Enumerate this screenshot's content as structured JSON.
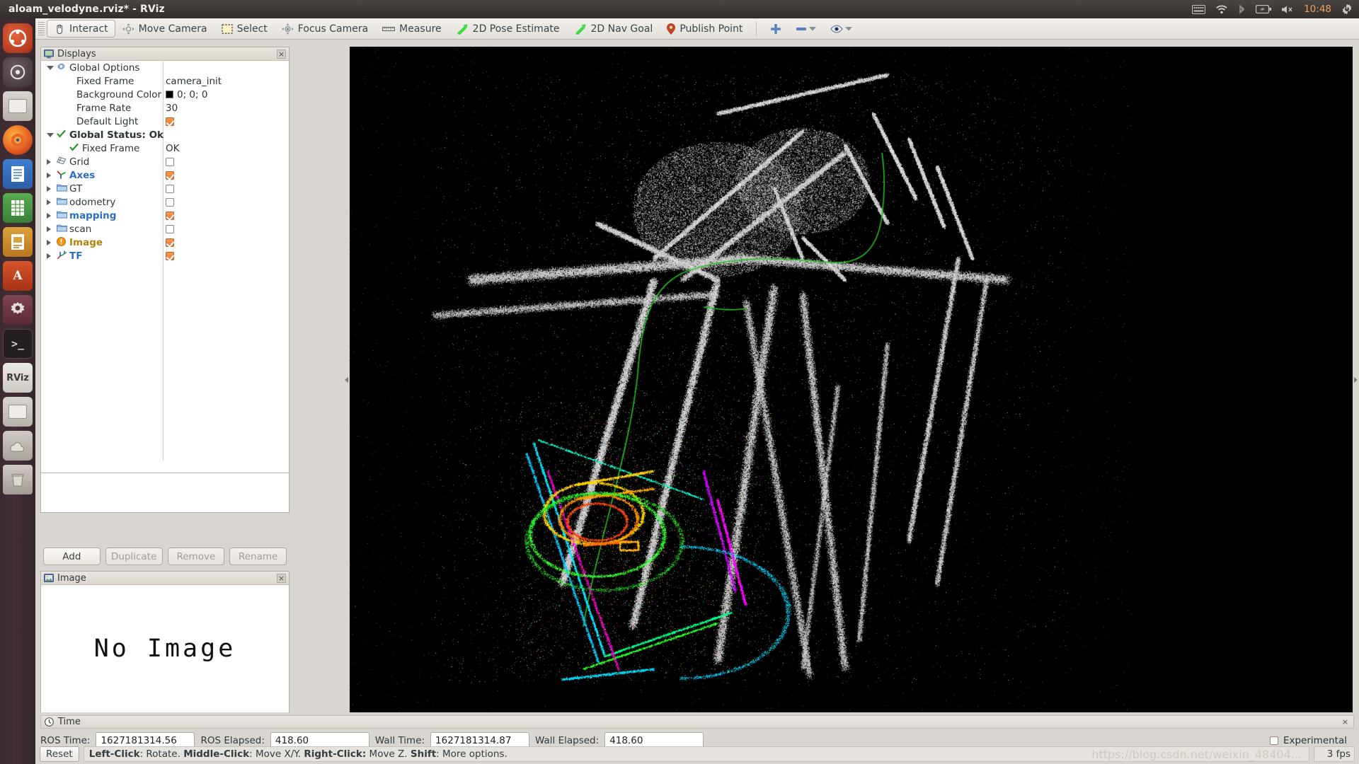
{
  "window": {
    "title": "aloam_velodyne.rviz* - RViz"
  },
  "tray": {
    "clock": "10:48",
    "icons": [
      "keyboard-icon",
      "wifi-icon",
      "bluetooth-icon",
      "battery-icon",
      "volume-muted-icon",
      "power-gear-icon"
    ]
  },
  "launcher": {
    "items": [
      "ubuntu-dash",
      "files-manager",
      "firefox",
      "libreoffice-writer",
      "libreoffice-calc",
      "libreoffice-impress",
      "amazon",
      "system-settings",
      "terminal",
      "rviz",
      "archive-manager",
      "software-updater",
      "trash"
    ],
    "rviz_label": "RViz"
  },
  "toolbar": {
    "tools": [
      {
        "label": "Interact",
        "icon": "hand-cursor-icon",
        "active": true
      },
      {
        "label": "Move Camera",
        "icon": "move-camera-icon",
        "active": false
      },
      {
        "label": "Select",
        "icon": "selection-box-icon",
        "active": false
      },
      {
        "label": "Focus Camera",
        "icon": "focus-camera-icon",
        "active": false
      },
      {
        "label": "Measure",
        "icon": "ruler-icon",
        "active": false
      },
      {
        "label": "2D Pose Estimate",
        "icon": "green-arrow-icon",
        "active": false
      },
      {
        "label": "2D Nav Goal",
        "icon": "green-arrow-icon",
        "active": false
      },
      {
        "label": "Publish Point",
        "icon": "map-pin-icon",
        "active": false
      }
    ],
    "extras": [
      "plus-icon",
      "minus-icon",
      "chevron-down-icon",
      "eye-icon",
      "chevron-down-icon"
    ]
  },
  "displays_panel": {
    "title": "Displays",
    "icon": "monitor-icon",
    "close_label": "×",
    "tree": [
      {
        "indent": 0,
        "expander": "open",
        "icon": "gear-icon",
        "label": "Global Options",
        "bold": false,
        "color": "#2e3436",
        "value_type": "none",
        "value": ""
      },
      {
        "indent": 1,
        "expander": "none",
        "icon": "none",
        "label": "Fixed Frame",
        "bold": false,
        "color": "#2e3436",
        "value_type": "text",
        "value": "camera_init"
      },
      {
        "indent": 1,
        "expander": "none",
        "icon": "none",
        "label": "Background Color",
        "bold": false,
        "color": "#2e3436",
        "value_type": "swatch",
        "value": "0; 0; 0",
        "swatch_color": "#000000"
      },
      {
        "indent": 1,
        "expander": "none",
        "icon": "none",
        "label": "Frame Rate",
        "bold": false,
        "color": "#2e3436",
        "value_type": "text",
        "value": "30"
      },
      {
        "indent": 1,
        "expander": "none",
        "icon": "none",
        "label": "Default Light",
        "bold": false,
        "color": "#2e3436",
        "value_type": "check",
        "value": "checked"
      },
      {
        "indent": 0,
        "expander": "open",
        "icon": "check-icon",
        "label": "Global Status: Ok",
        "bold": true,
        "color": "#2e3436",
        "value_type": "none",
        "value": ""
      },
      {
        "indent": 1,
        "expander": "none",
        "icon": "check-icon",
        "label": "Fixed Frame",
        "bold": false,
        "color": "#2e3436",
        "value_type": "text",
        "value": "OK"
      },
      {
        "indent": 0,
        "expander": "closed",
        "icon": "grid-icon",
        "label": "Grid",
        "bold": false,
        "color": "#2e3436",
        "value_type": "check",
        "value": "unchecked"
      },
      {
        "indent": 0,
        "expander": "closed",
        "icon": "axes-icon",
        "label": "Axes",
        "bold": true,
        "color": "#2b6ec4",
        "value_type": "check",
        "value": "checked"
      },
      {
        "indent": 0,
        "expander": "closed",
        "icon": "folder-icon",
        "label": "GT",
        "bold": false,
        "color": "#2e3436",
        "value_type": "check",
        "value": "unchecked"
      },
      {
        "indent": 0,
        "expander": "closed",
        "icon": "folder-icon",
        "label": "odometry",
        "bold": false,
        "color": "#2e3436",
        "value_type": "check",
        "value": "unchecked"
      },
      {
        "indent": 0,
        "expander": "closed",
        "icon": "folder-icon",
        "label": "mapping",
        "bold": true,
        "color": "#2b6ec4",
        "value_type": "check",
        "value": "checked"
      },
      {
        "indent": 0,
        "expander": "closed",
        "icon": "folder-icon",
        "label": "scan",
        "bold": false,
        "color": "#2e3436",
        "value_type": "check",
        "value": "unchecked"
      },
      {
        "indent": 0,
        "expander": "closed",
        "icon": "warning-icon",
        "label": "Image",
        "bold": true,
        "color": "#b5820c",
        "value_type": "check",
        "value": "checked"
      },
      {
        "indent": 0,
        "expander": "closed",
        "icon": "tf-icon",
        "label": "TF",
        "bold": true,
        "color": "#2b6ec4",
        "value_type": "check",
        "value": "checked"
      }
    ],
    "buttons": [
      {
        "label": "Add",
        "enabled": true
      },
      {
        "label": "Duplicate",
        "enabled": false
      },
      {
        "label": "Remove",
        "enabled": false
      },
      {
        "label": "Rename",
        "enabled": false
      }
    ]
  },
  "image_panel": {
    "title": "Image",
    "icon": "image-icon",
    "close_label": "×",
    "message": "No Image"
  },
  "time_panel": {
    "title": "Time",
    "icon": "clock-icon",
    "close_label": "×",
    "fields": [
      {
        "label": "ROS Time:",
        "value": "1627181314.56"
      },
      {
        "label": "ROS Elapsed:",
        "value": "418.60"
      },
      {
        "label": "Wall Time:",
        "value": "1627181314.87"
      },
      {
        "label": "Wall Elapsed:",
        "value": "418.60"
      }
    ],
    "experimental_label": "Experimental",
    "experimental_checked": false
  },
  "status_bar": {
    "reset_label": "Reset",
    "hint_parts": [
      {
        "text": "Left-Click",
        "bold": true
      },
      {
        "text": ": Rotate. ",
        "bold": false
      },
      {
        "text": "Middle-Click",
        "bold": true
      },
      {
        "text": ": Move X/Y. ",
        "bold": false
      },
      {
        "text": "Right-Click:",
        "bold": true
      },
      {
        "text": " Move Z. ",
        "bold": false
      },
      {
        "text": "Shift",
        "bold": true
      },
      {
        "text": ": More options.",
        "bold": false
      }
    ],
    "watermark": "https://blog.csdn.net/weixin_48404...",
    "fps": "3 fps"
  },
  "viewport": {
    "background": "#000000",
    "point_colors": [
      "#ffffff",
      "#00ff00",
      "#ff00ff",
      "#00ffff",
      "#ffaa00",
      "#ff3300",
      "#ffff00"
    ],
    "trajectory_color": "#22c422"
  }
}
